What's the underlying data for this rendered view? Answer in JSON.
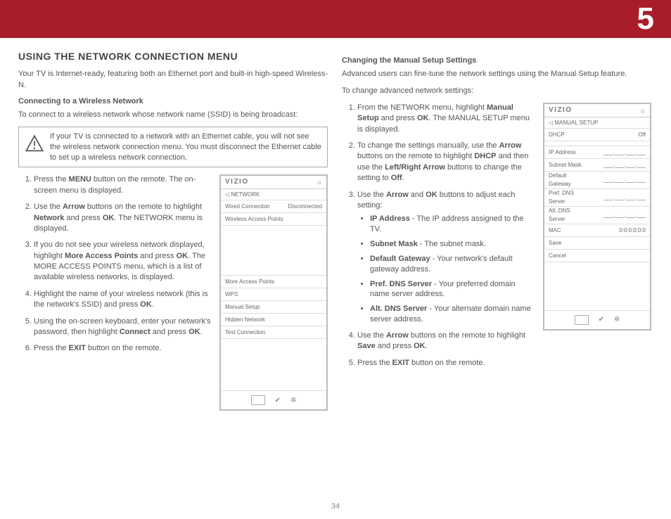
{
  "chapter_number": "5",
  "page_number": "34",
  "left": {
    "title": "USING THE NETWORK CONNECTION MENU",
    "intro": "Your TV is Internet-ready, featuring both an Ethernet port and built-in high-speed Wireless-N.",
    "sub1": "Connecting to a Wireless Network",
    "sub1_text": "To connect to a wireless network whose network name (SSID) is being broadcast:",
    "note": "If your TV is connected to a network with an Ethernet cable, you will not see the wireless network connection menu. You must disconnect the Ethernet cable to set up a wireless network connection.",
    "step1_a": "Press the ",
    "step1_b": "MENU",
    "step1_c": " button on the remote. The on-screen menu is displayed.",
    "step2_a": "Use the ",
    "step2_b": "Arrow",
    "step2_c": " buttons on the remote to highlight ",
    "step2_d": "Network",
    "step2_e": " and press ",
    "step2_f": "OK",
    "step2_g": ". The NETWORK menu is displayed.",
    "step3_a": "If you do not see your wireless network displayed, highlight ",
    "step3_b": "More Access Points",
    "step3_c": " and press ",
    "step3_d": "OK",
    "step3_e": ". The MORE ACCESS POINTS menu, which is a list of available wireless networks, is displayed.",
    "step4_a": "Highlight the name of your wireless network (this is the network's SSID) and press ",
    "step4_b": "OK",
    "step4_c": ".",
    "step5_a": "Using the on-screen keyboard, enter your network's password, then highlight ",
    "step5_b": "Connect",
    "step5_c": " and press ",
    "step5_d": "OK",
    "step5_e": ".",
    "step6_a": "Press the ",
    "step6_b": "EXIT",
    "step6_c": " button on the remote."
  },
  "right": {
    "sub1": "Changing the Manual Setup Settings",
    "intro": "Advanced users can fine-tune the network settings using the Manual Setup feature.",
    "lead": "To change advanced network settings:",
    "s1_a": "From the NETWORK menu, highlight ",
    "s1_b": "Manual Setup",
    "s1_c": " and press ",
    "s1_d": "OK",
    "s1_e": ". The MANUAL SETUP menu is displayed.",
    "s2_a": "To change the settings manually, use the ",
    "s2_b": "Arrow",
    "s2_c": " buttons on the remote to highlight ",
    "s2_d": "DHCP",
    "s2_e": " and then use the ",
    "s2_f": "Left/Right Arrow",
    "s2_g": " buttons to change the setting to ",
    "s2_h": "Off",
    "s2_i": ".",
    "s3_a": "Use the ",
    "s3_b": "Arrow",
    "s3_c": " and ",
    "s3_d": "OK",
    "s3_e": " buttons to adjust each setting:",
    "b1_a": "IP Address",
    "b1_b": " - The IP address assigned to the TV.",
    "b2_a": "Subnet Mask",
    "b2_b": " - The subnet mask.",
    "b3_a": "Default Gateway",
    "b3_b": " - Your network's default gateway address.",
    "b4_a": "Pref. DNS Server",
    "b4_b": " - Your preferred domain name server address.",
    "b5_a": "Alt. DNS Server",
    "b5_b": " - Your alternate domain name server address.",
    "s4_a": "Use the ",
    "s4_b": "Arrow",
    "s4_c": " buttons on the remote to highlight ",
    "s4_d": "Save",
    "s4_e": " and press ",
    "s4_f": "OK",
    "s4_g": ".",
    "s5_a": "Press the ",
    "s5_b": "EXIT",
    "s5_c": " button on the remote."
  },
  "shot1": {
    "brand": "VIZIO",
    "crumb": "NETWORK",
    "row_wired_l": "Wired Connection",
    "row_wired_r": "Disconnected",
    "row_wap": "Wireless Access Points",
    "row_more": "More Access Points",
    "row_wps": "WPS",
    "row_manual": "Manual Setup",
    "row_hidden": "Hidden Network",
    "row_test": "Test Connection"
  },
  "shot2": {
    "brand": "VIZIO",
    "crumb": "MANUAL SETUP",
    "row_dhcp_l": "DHCP",
    "row_dhcp_r": "Off",
    "row_ip": "IP Address",
    "row_subnet": "Subnet Mask",
    "row_gateway_l1": "Default",
    "row_gateway_l2": "Gateway",
    "row_pdns_l1": "Pref. DNS",
    "row_pdns_l2": "Server",
    "row_adns_l1": "Alt. DNS",
    "row_adns_l2": "Server",
    "row_mac_l": "MAC",
    "row_mac_r": "0:0:0:0:0:0",
    "row_save": "Save",
    "row_cancel": "Cancel",
    "blank_field": "___.___.___.___"
  }
}
